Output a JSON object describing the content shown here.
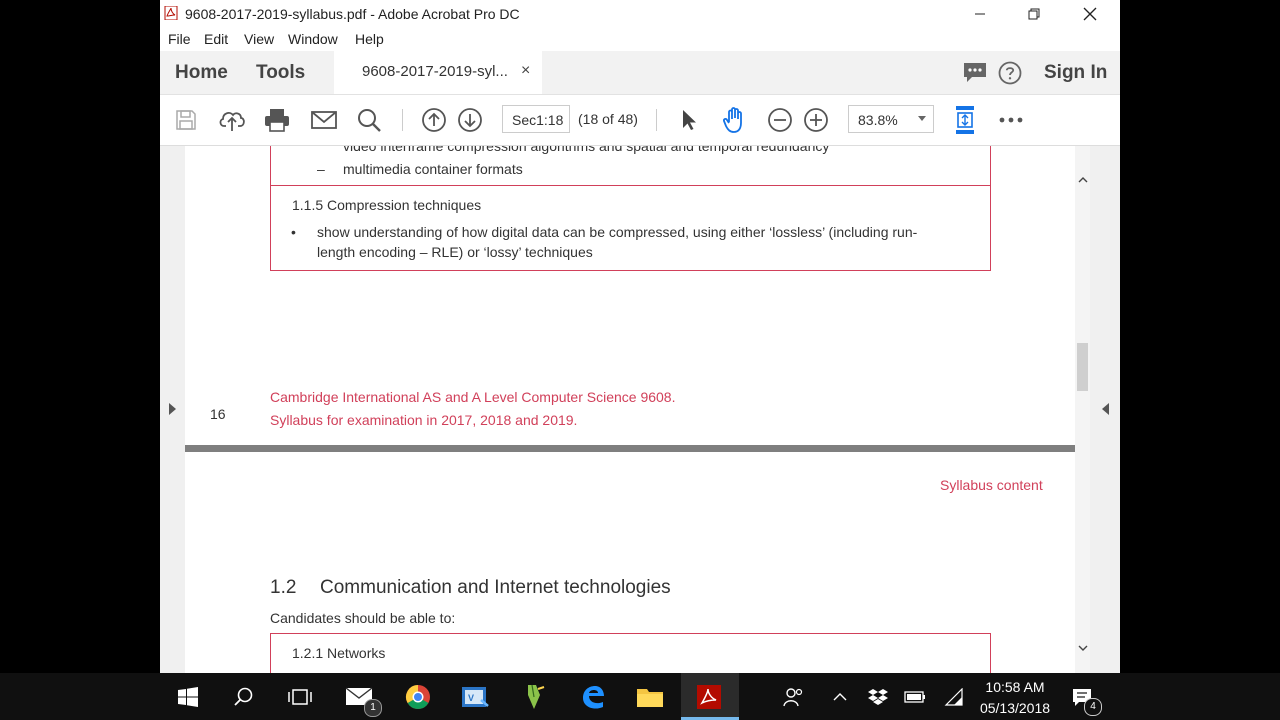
{
  "window": {
    "title": "9608-2017-2019-syllabus.pdf - Adobe Acrobat Pro DC",
    "menu": [
      "File",
      "Edit",
      "View",
      "Window",
      "Help"
    ]
  },
  "tabs": {
    "home": "Home",
    "tools": "Tools",
    "document": "9608-2017-2019-syl...",
    "close": "×",
    "sign_in": "Sign In"
  },
  "toolbar": {
    "page_field": "Sec1:18",
    "page_count": "(18 of 48)",
    "zoom": "83.8%"
  },
  "document": {
    "top_cut_line": "video interframe compression algorithms and spatial and temporal redundancy",
    "bullet_dash": "–",
    "container_formats": "multimedia container formats",
    "section_115": "1.1.5  Compression techniques",
    "bullet": "•",
    "compression_line1": "show understanding of how digital data can be compressed, using either ‘lossless’ (including run-",
    "compression_line2": "length encoding – RLE) or ‘lossy’ techniques",
    "page_number": "16",
    "footer_line1": "Cambridge International AS and A Level Computer Science 9608.",
    "footer_line2": "Syllabus for examination in 2017, 2018 and 2019.",
    "header_right": "Syllabus content",
    "section_12_number": "1.2",
    "section_12_title": "Communication and Internet technologies",
    "candidates": "Candidates should be able to:",
    "section_121": "1.2.1  Networks"
  },
  "taskbar": {
    "mail_badge": "1",
    "notification_badge": "4",
    "time": "10:58 AM",
    "date": "05/13/2018"
  },
  "colors": {
    "accent_pink": "#d1405a",
    "acrobat_red": "#b30b00",
    "tool_blue": "#1473e6"
  }
}
